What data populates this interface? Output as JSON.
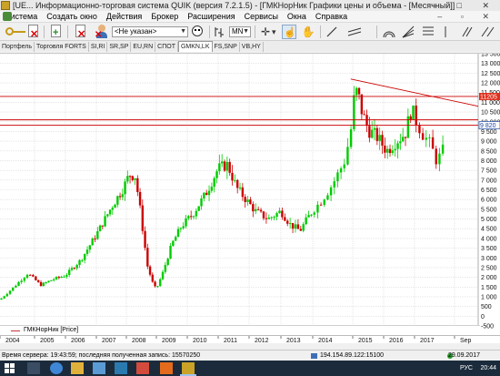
{
  "window": {
    "title": "[UE... Информационно-торговая система QUIK (версия 7.2.1.5) - [ГМКНорНик Графики цены и объема - [Месячный]]",
    "controls": "–  □  ✕"
  },
  "menu": {
    "items": [
      "Система",
      "Создать окно",
      "Действия",
      "Брокер",
      "Расширения",
      "Сервисы",
      "Окна",
      "Справка"
    ],
    "inner_controls": "–  ▫  ✕"
  },
  "toolbar": {
    "account_select": "<Не указан>",
    "interval_select": "MN"
  },
  "tabs": [
    "Портфель",
    "Торговля FORTS",
    "SI,RI",
    "SR,SP",
    "EU,RN",
    "СПОТ",
    "GMKN,LK",
    "FS,SNP",
    "VB,HY"
  ],
  "active_tab": "GMKN,LK",
  "legend": {
    "label": "ГМКНорНик [Price]",
    "color": "#c83232"
  },
  "chart_data": {
    "type": "candlestick",
    "y_ticks": [
      "13 500",
      "13 000",
      "12 500",
      "12 000",
      "11 500",
      "11 000",
      "10 500",
      "10 000",
      "9 500",
      "9 000",
      "8 500",
      "8 000",
      "7 500",
      "7 000",
      "6 500",
      "6 000",
      "5 500",
      "5 000",
      "4 500",
      "4 000",
      "3 500",
      "3 000",
      "2 500",
      "2 000",
      "1 500",
      "1 000",
      "500",
      "0",
      "-500"
    ],
    "ylim": [
      -500,
      13500
    ],
    "x_ticks": [
      "2004",
      "2005",
      "2006",
      "2007",
      "2008",
      "2009",
      "2010",
      "2011",
      "2012",
      "2013",
      "2014",
      "2015",
      "2016",
      "2017",
      "Sep"
    ],
    "price_label_red": "11205",
    "price_label_blue": "9 820",
    "horizontal_levels": [
      11300,
      10100,
      9820
    ],
    "trendline": {
      "from": [
        "2014-12",
        12200
      ],
      "to": [
        "2017-08",
        10800
      ]
    },
    "colors": {
      "up": "#00cc00",
      "down": "#cc0000",
      "levels": "#cc0000",
      "trend": "#cc0000"
    },
    "grid": true
  },
  "status": {
    "server_time": "Время сервера: 19:43:59; последняя полученная запись: 15570250",
    "connection": "194.154.89.122:15100",
    "date": "29.09.2017"
  },
  "taskbar": {
    "lang": "РУС",
    "time": "20:44"
  }
}
